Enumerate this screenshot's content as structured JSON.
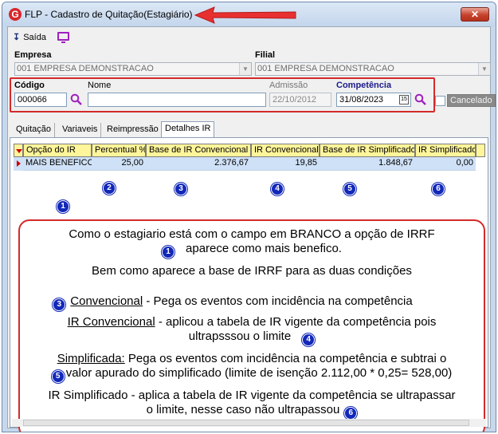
{
  "window": {
    "title": "FLP - Cadastro de Quitação(Estagiário)",
    "app_icon": "G",
    "close_label": "✕"
  },
  "menu": {
    "exit_label": "Saída",
    "exit_icon": "↧",
    "monitor_icon": "monitor-icon"
  },
  "form": {
    "empresa_label": "Empresa",
    "empresa_value": "001 EMPRESA DEMONSTRACAO",
    "filial_label": "Filial",
    "filial_value": "001 EMPRESA DEMONSTRACAO",
    "codigo_label": "Código",
    "codigo_value": "000066",
    "nome_label": "Nome",
    "nome_value": "",
    "admissao_label": "Admissão",
    "admissao_value": "22/10/2012",
    "competencia_label": "Competência",
    "competencia_value": "31/08/2023",
    "calendar_icon": "15",
    "cancelado_label": "Cancelado"
  },
  "tabs": [
    {
      "label": "Quitação"
    },
    {
      "label": "Variaveis"
    },
    {
      "label": "Reimpressão"
    },
    {
      "label": "Detalhes IR"
    }
  ],
  "grid": {
    "headers": [
      "Opção do IR",
      "Percentual %",
      "Base de IR Convencional",
      "IR Convencional",
      "Base de IR Simplificado",
      "IR Simplificado"
    ],
    "row": [
      "MAIS BENEFICO",
      "25,00",
      "2.376,67",
      "19,85",
      "1.848,67",
      "0,00"
    ]
  },
  "badges": [
    "1",
    "2",
    "3",
    "4",
    "5",
    "6"
  ],
  "note": {
    "line1": "Como o estagiario está com o campo em BRANCO a opção de IRRF",
    "line2": "aparece como mais benefico.",
    "line3": "Bem como aparece a base de IRRF para as duas condições",
    "conv_title": "Convencional",
    "conv_text": " - Pega os eventos com incidência na competência",
    "irconv_title": "IR Convencional",
    "irconv_text": " - aplicou a tabela de IR vigente da competência pois",
    "irconv_text2": "ultrapsssou o limite",
    "simp_title": "Simplificada:",
    "simp_text": " Pega os eventos com incidência na competência e subtrai o",
    "simp_text2": "valor apurado do simplificado (limite de isenção 2.112,00 * 0,25= 528,00)",
    "irsimp_text": "IR Simplificado - aplica a tabela de IR vigente da competência se ultrapassar",
    "irsimp_text2": "o limite, nesse caso não ultrapassou"
  },
  "colors": {
    "header_yellow": "#fff59a",
    "selected_row": "#cfe1f7",
    "badge_blue": "#1228b8",
    "annotation_red": "#d42a2a"
  }
}
